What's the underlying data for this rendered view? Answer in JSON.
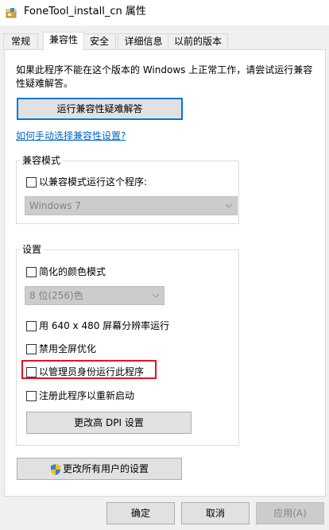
{
  "window": {
    "title": "FoneTool_install_cn 属性"
  },
  "tabs": [
    {
      "label": "常规"
    },
    {
      "label": "兼容性"
    },
    {
      "label": "安全"
    },
    {
      "label": "详细信息"
    },
    {
      "label": "以前的版本"
    }
  ],
  "compat": {
    "intro": "如果此程序不能在这个版本的 Windows 上正常工作，请尝试运行兼容性疑难解答。",
    "troubleshoot_button": "运行兼容性疑难解答",
    "manual_link": "如何手动选择兼容性设置?",
    "mode_group": {
      "label": "兼容模式",
      "checkbox_label": "以兼容模式运行这个程序:",
      "checked": false,
      "select_value": "Windows 7"
    },
    "settings_group": {
      "label": "设置",
      "reduced_color": {
        "label": "简化的颜色模式",
        "checked": false
      },
      "color_select_value": "8 位(256)色",
      "res_640": {
        "label": "用 640 x 480 屏幕分辨率运行",
        "checked": false
      },
      "disable_fullscreen": {
        "label": "禁用全屏优化",
        "checked": false
      },
      "run_as_admin": {
        "label": "以管理员身份运行此程序",
        "checked": false
      },
      "register_restart": {
        "label": "注册此程序以重新启动",
        "checked": false
      },
      "dpi_button": "更改高 DPI 设置"
    },
    "all_users_button": "更改所有用户的设置"
  },
  "footer": {
    "ok": "确定",
    "cancel": "取消",
    "apply": "应用(A)"
  },
  "icons": {
    "app": "installer-package-icon",
    "shield": "uac-shield-icon",
    "chevron": "chevron-down-icon"
  },
  "colors": {
    "accent": "#0078d7",
    "link": "#0066cc",
    "highlight": "#e81123"
  }
}
